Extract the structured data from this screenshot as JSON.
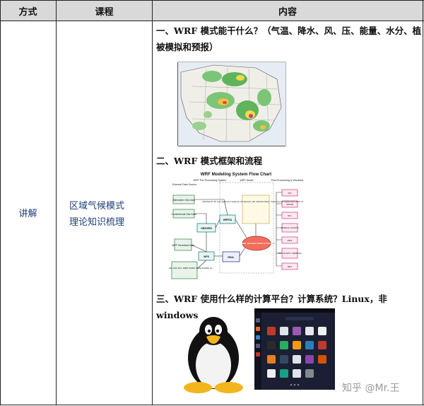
{
  "header": {
    "col1": "方式",
    "col2": "课程",
    "col3": "内容"
  },
  "row": {
    "method": "讲解",
    "course_line1": "区域气候模式",
    "course_line2": "理论知识梳理"
  },
  "sections": {
    "s1_line1": "一、WRF 模式能干什么？（气温、降水、风、压、能量、水分、植",
    "s1_line2": "被模拟和预报）",
    "s2": "二、WRF 模式框架和流程",
    "s3": "三、WRF 使用什么样的计算平台？计算系统？Linux，非 windows"
  },
  "flowchart": {
    "title": "WRF Modeling System Flow Chart",
    "col_external": "External Data Source",
    "col_pre": "WRF Pre-Processing System",
    "col_model": "WRF Model",
    "col_post": "Post-Processing & Visualization",
    "box_alt": "Alternative Obs Data",
    "box_conv": "Conventional Obs Data",
    "box_terr": "WRF Terrestrial Data",
    "box_grid": "Gridded Data: NAM, GFS, RUC, NNRP, NCEP2, NARR, ECMWF, etc.",
    "box_obsgrid": "OBSGRID",
    "box_wrfda": "WRFDA",
    "box_wps": "WPS",
    "box_real": "REAL",
    "box_ideal": "Ideal Data 2D: Hill, Grav, Squall Line & Seabreeze 3D: Supercell ; LES ; Baroclinic Waves ; Surface Fire and Tropical Storm Global: heldsuarez",
    "box_arw": "ARW MODEL (includes Chem & Fire modules)",
    "post": [
      "IDV",
      "VAPOR",
      "NCL",
      "ARWpost (GrADS)",
      "RIP4",
      "UPP (GrADS / GEMPAK)",
      "MET"
    ]
  },
  "watermark": "知乎 @Mr.王"
}
